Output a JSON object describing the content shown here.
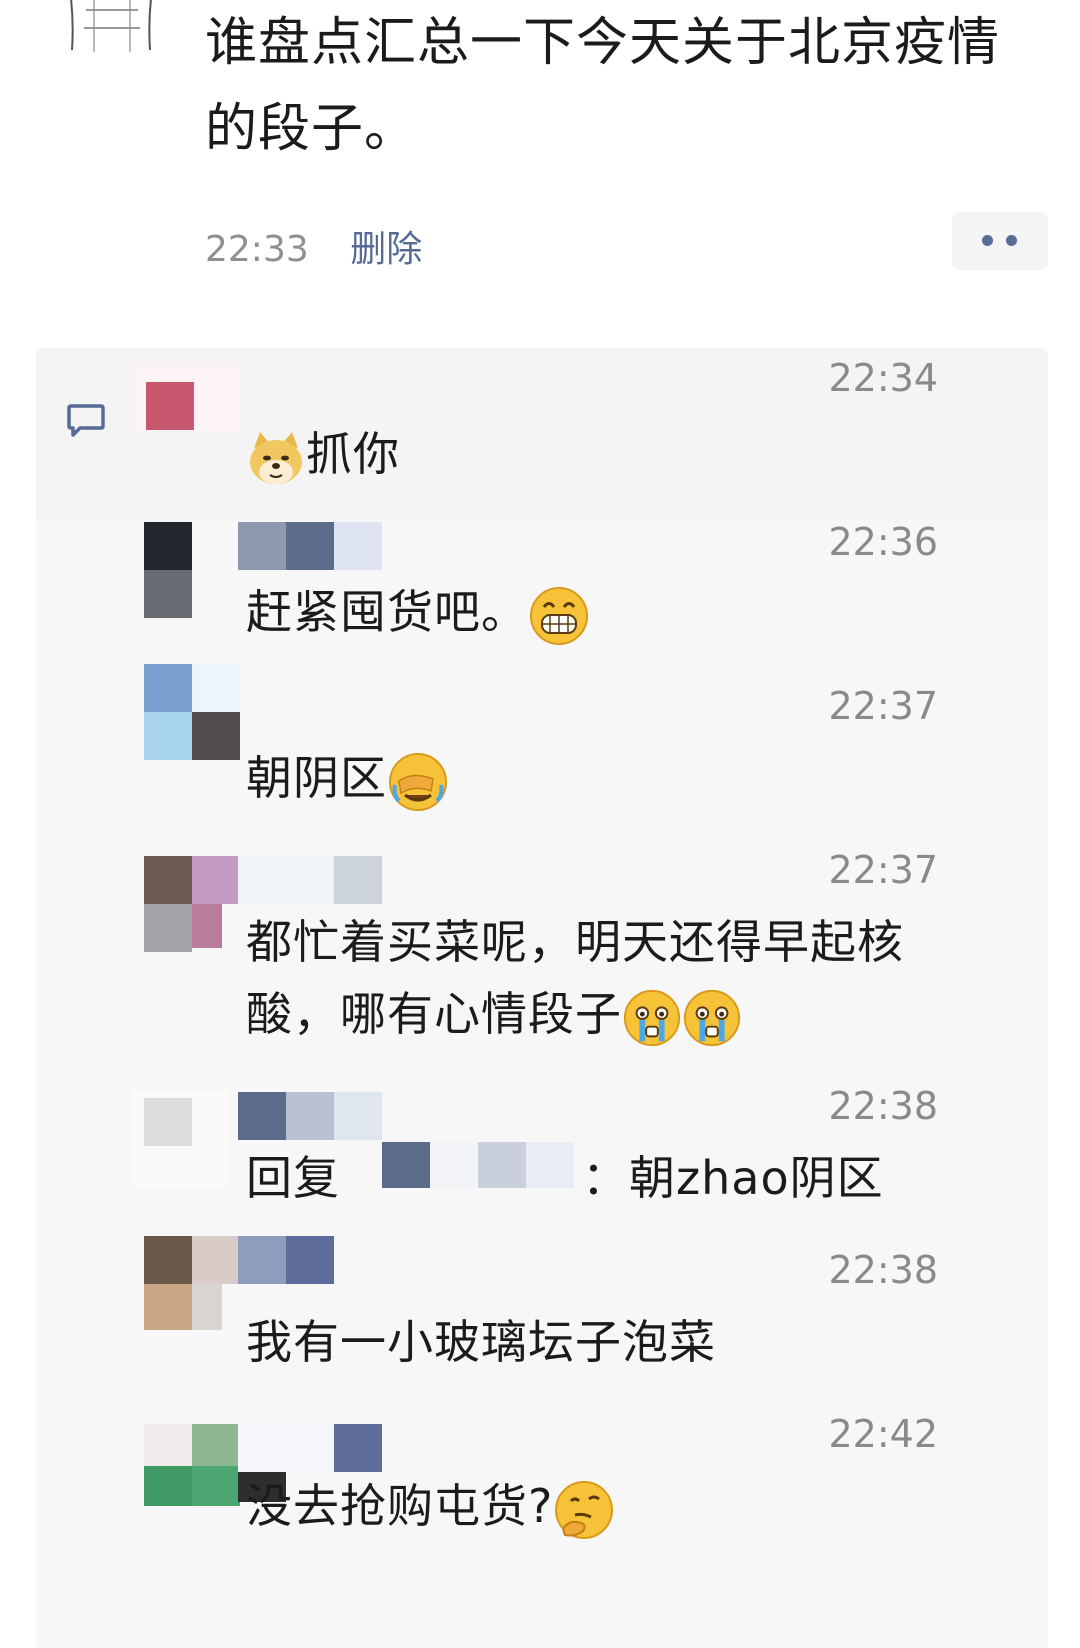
{
  "post": {
    "text": "谁盘点汇总一下今天关于北京疫情的段子。",
    "time": "22:33",
    "delete_label": "删除"
  },
  "comments": [
    {
      "time": "22:34",
      "text": "抓你",
      "emoji_before": "doge-icon"
    },
    {
      "time": "22:36",
      "text": "赶紧囤货吧。",
      "emoji_after": "grin-icon"
    },
    {
      "time": "22:37",
      "text": "朝阴区",
      "emoji_after": "facepalm-cry-icon"
    },
    {
      "time": "22:37",
      "text_line1": "都忙着买菜呢，明天还得早起核",
      "text_line2": "酸，哪有心情段子",
      "emoji_after": "crying-icon"
    },
    {
      "time": "22:38",
      "reply_label": "回复",
      "reply_text": "：朝zhao阴区"
    },
    {
      "time": "22:38",
      "text": "我有一小玻璃坛子泡菜"
    },
    {
      "time": "22:42",
      "text": "没去抢购屯货?",
      "emoji_after": "thinking-icon"
    }
  ],
  "colors": {
    "link": "#576b95",
    "time": "#8a8a8a",
    "panel": "#f7f7f7"
  }
}
